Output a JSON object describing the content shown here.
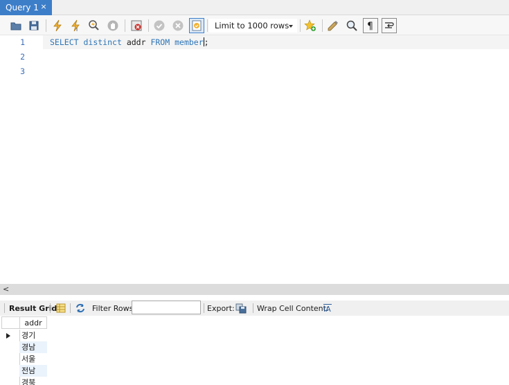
{
  "tab": {
    "title": "Query 1",
    "close": "×"
  },
  "toolbar": {
    "buttons": [
      "open-file-icon",
      "save-icon",
      "execute-icon",
      "execute-current-icon",
      "explain-icon",
      "stop-icon",
      "toggle-error-icon",
      "commit-icon",
      "rollback-icon",
      "autocommit-icon",
      "add-snippet-icon",
      "beautify-icon",
      "find-icon",
      "invisible-chars-icon",
      "wrap-icon"
    ],
    "limit_label": "Limit to 1000 rows"
  },
  "editor": {
    "line_numbers": [
      "1",
      "2",
      "3"
    ],
    "code": {
      "kw1": "SELECT",
      "kw2": "distinct",
      "ident1": "addr",
      "kw3": "FROM",
      "ident2": "member",
      "tail": ";"
    }
  },
  "results": {
    "tab_label": "Result Grid",
    "filter_label": "Filter Rows:",
    "filter_value": "",
    "export_label": "Export:",
    "wrap_label": "Wrap Cell Content:",
    "column": "addr",
    "rows": [
      "경기",
      "경남",
      "서울",
      "전남",
      "경북"
    ]
  },
  "colors": {
    "tab_active": "#3d7ec9",
    "keyword": "#2e75b6",
    "line_number": "#3d6fb8",
    "row_alt": "#eaf2fb"
  }
}
